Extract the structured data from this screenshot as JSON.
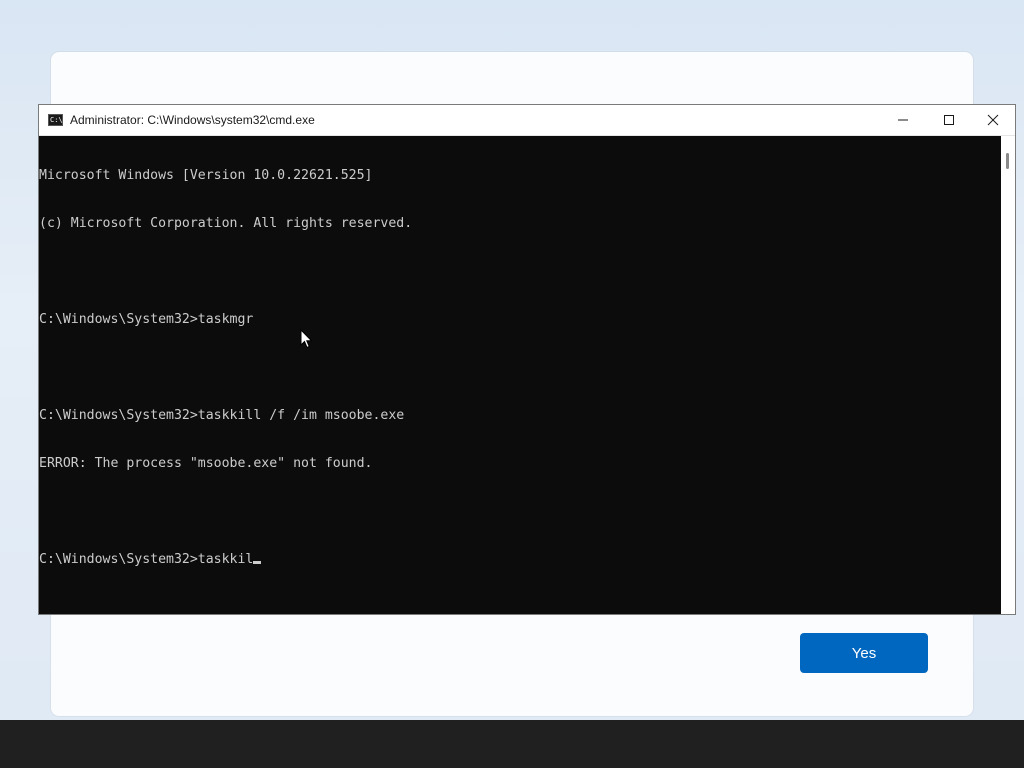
{
  "oobe": {
    "yes_label": "Yes"
  },
  "cmd": {
    "title": "Administrator: C:\\Windows\\system32\\cmd.exe",
    "icon_glyph": "C:\\",
    "lines": [
      "Microsoft Windows [Version 10.0.22621.525]",
      "(c) Microsoft Corporation. All rights reserved.",
      "",
      "C:\\Windows\\System32>taskmgr",
      "",
      "C:\\Windows\\System32>taskkill /f /im msoobe.exe",
      "ERROR: The process \"msoobe.exe\" not found.",
      ""
    ],
    "current_prompt": "C:\\Windows\\System32>taskkil"
  },
  "colors": {
    "console_bg": "#0c0c0c",
    "console_fg": "#cccccc",
    "accent": "#0067c0",
    "taskbar": "#202020"
  },
  "icons": [
    "cmd-app-icon",
    "minimize-icon",
    "maximize-icon",
    "close-icon",
    "mouse-pointer-icon"
  ]
}
